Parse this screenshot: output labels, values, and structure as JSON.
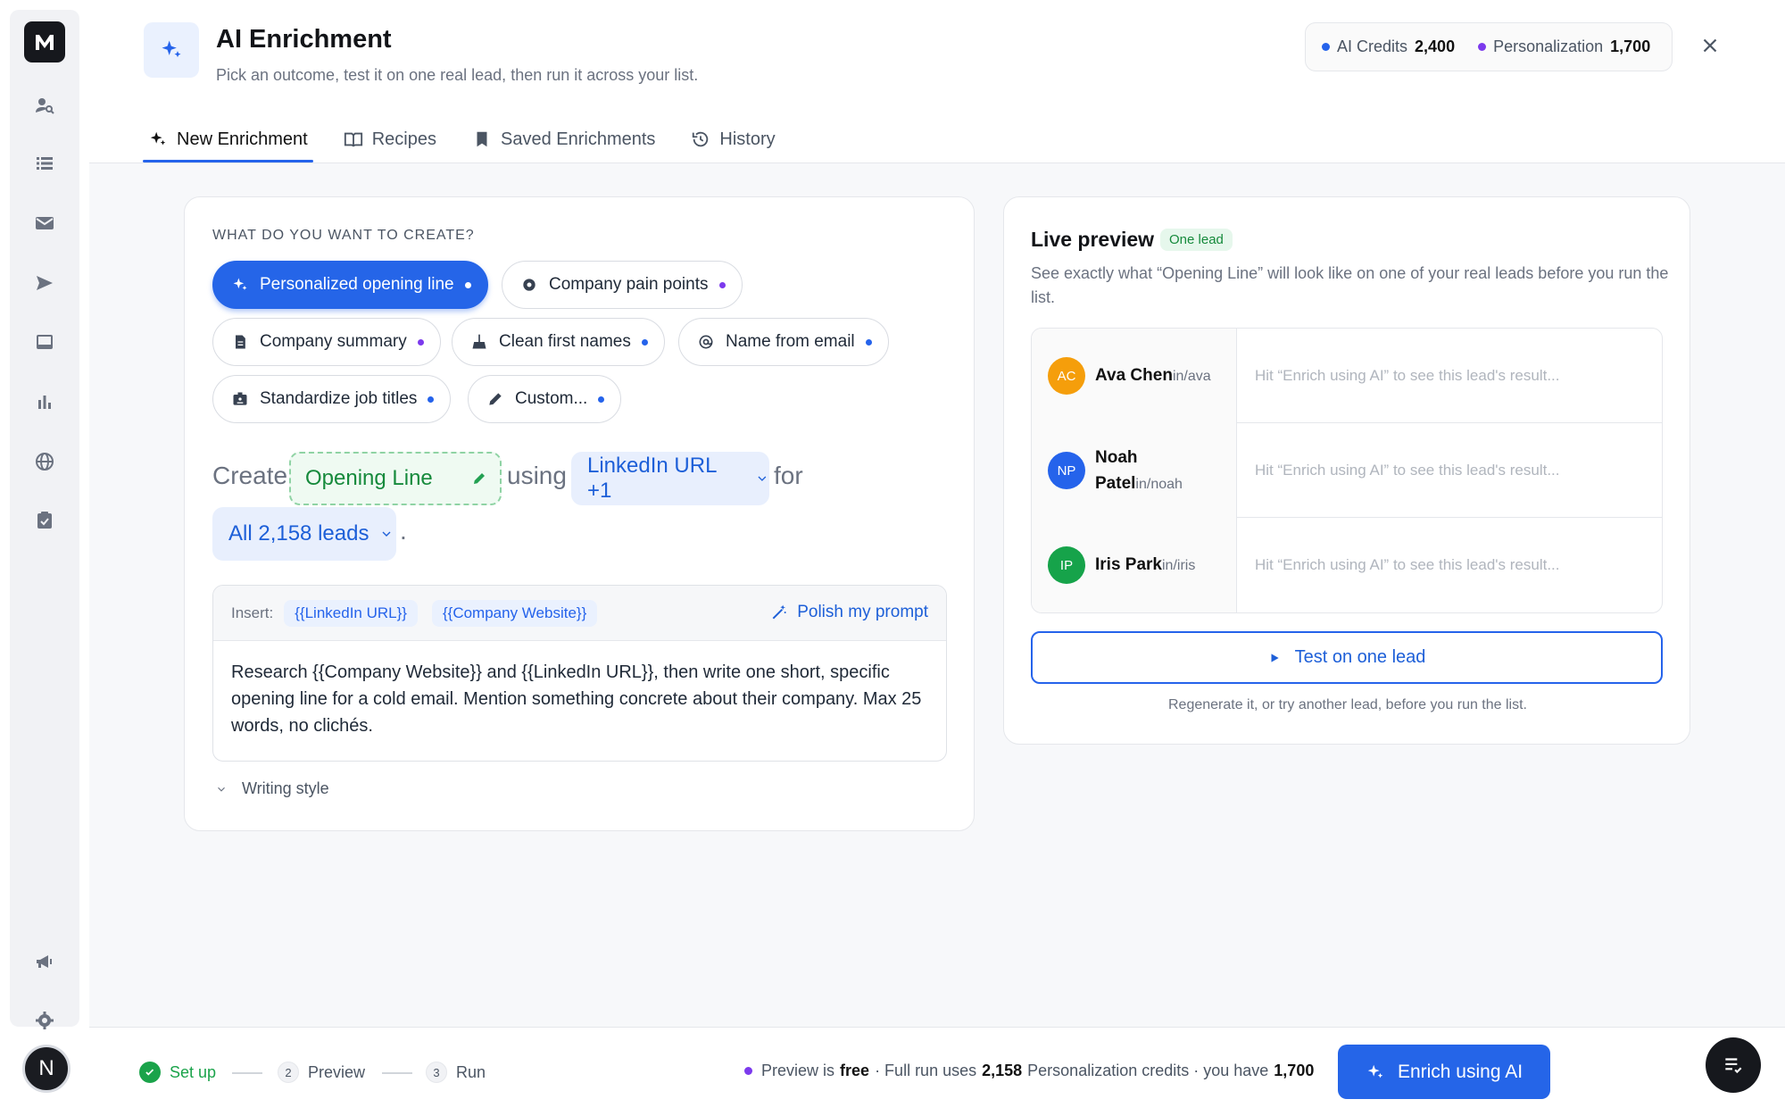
{
  "header": {
    "title": "AI Enrichment",
    "subtitle": "Pick an outcome, test it on one real lead, then run it across your list."
  },
  "credits": {
    "ai_label": "AI Credits",
    "ai_value": "2,400",
    "ai_color": "#2563eb",
    "personalization_label": "Personalization",
    "personalization_value": "1,700",
    "personalization_color": "#7c3aed"
  },
  "tabs": [
    {
      "label": "New Enrichment",
      "icon": "sparkles-icon",
      "active": true
    },
    {
      "label": "Recipes",
      "icon": "book-icon"
    },
    {
      "label": "Saved Enrichments",
      "icon": "bookmark-icon"
    },
    {
      "label": "History",
      "icon": "history-icon"
    }
  ],
  "create": {
    "section_label": "WHAT DO YOU WANT TO CREATE?",
    "chips": [
      {
        "label": "Personalized opening line",
        "icon": "sparkles-icon",
        "active": true
      },
      {
        "label": "Company pain points",
        "icon": "target-icon",
        "dot_color": "#7c3aed"
      },
      {
        "label": "Company summary",
        "icon": "document-icon",
        "dot_color": "#7c3aed"
      },
      {
        "label": "Clean first names",
        "icon": "broom-icon",
        "dot_color": "#2563eb"
      },
      {
        "label": "Name from email",
        "icon": "at-icon",
        "dot_color": "#2563eb"
      },
      {
        "label": "Standardize job titles",
        "icon": "badge-icon",
        "dot_color": "#2563eb"
      },
      {
        "label": "Custom...",
        "icon": "pencil-icon",
        "dot_color": "#2563eb"
      }
    ],
    "sentence": {
      "create_word": "Create",
      "output_field": "Opening Line",
      "using_word": "using",
      "input_field": "LinkedIn URL +1",
      "for_word": "for",
      "scope": "All 2,158 leads",
      "period": "."
    },
    "prompt": {
      "insert_label": "Insert:",
      "vars": [
        "{{LinkedIn URL}}",
        "{{Company Website}}"
      ],
      "polish_label": "Polish my prompt",
      "text": "Research {{Company Website}} and {{LinkedIn URL}}, then write one short, specific opening line for a cold email. Mention something concrete about their company. Max 25 words, no clichés."
    },
    "writing_style_label": "Writing style"
  },
  "preview": {
    "title": "Live preview",
    "badge": "One lead",
    "description": "See exactly what “Opening Line” will look like on one of your real leads before you run the list.",
    "leads": [
      {
        "initials": "AC",
        "name": "Ava Chen",
        "handle": "in/ava",
        "color": "#f59e0b",
        "result": "Hit “Enrich using AI” to see this lead's result..."
      },
      {
        "initials": "NP",
        "name_line1": "Noah",
        "name_line2": "Patel",
        "handle": "in/noah",
        "color": "#2563eb",
        "result": "Hit “Enrich using AI” to see this lead's result..."
      },
      {
        "initials": "IP",
        "name": "Iris Park",
        "handle": "in/iris",
        "color": "#16a34a",
        "result": "Hit “Enrich using AI” to see this lead's result..."
      }
    ],
    "test_button": "Test on one lead",
    "footnote": "Regenerate it, or try another lead, before you run the list."
  },
  "footer": {
    "steps": [
      {
        "label": "Set up",
        "done": true
      },
      {
        "num": "2",
        "label": "Preview"
      },
      {
        "num": "3",
        "label": "Run"
      }
    ],
    "info_pre": "Preview is",
    "info_free": "free",
    "info_mid": "· Full run uses",
    "info_count": "2,158",
    "info_mid2": "Personalization credits · you have",
    "info_have": "1,700",
    "enrich_button": "Enrich using AI"
  },
  "user": {
    "initial": "N"
  }
}
